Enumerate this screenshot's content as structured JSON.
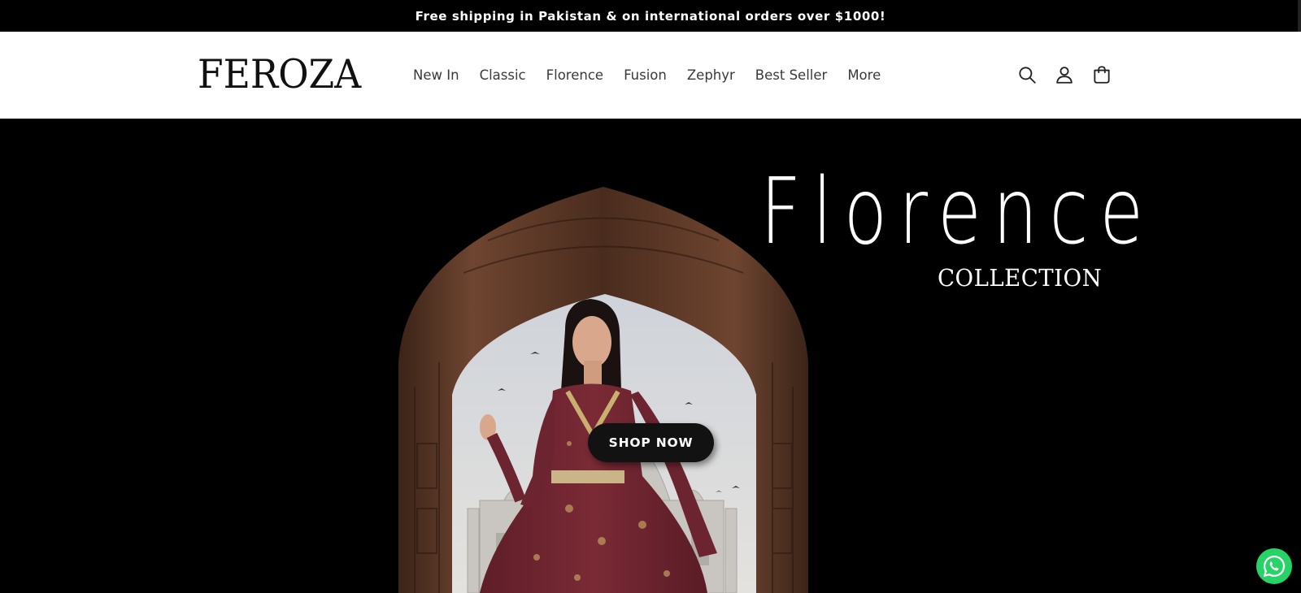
{
  "announcement": {
    "text": "Free shipping in Pakistan & on international orders over $1000!"
  },
  "header": {
    "logo_text": "FEROZA",
    "nav": [
      {
        "label": "New In"
      },
      {
        "label": "Classic"
      },
      {
        "label": "Florence"
      },
      {
        "label": "Fusion"
      },
      {
        "label": "Zephyr"
      },
      {
        "label": "Best Seller"
      },
      {
        "label": "More"
      }
    ],
    "icons": {
      "search": "search-icon",
      "account": "account-icon",
      "cart": "cart-icon"
    }
  },
  "hero": {
    "title": "Florence",
    "subtitle": "COLLECTION",
    "cta_label": "SHOP NOW",
    "image": "woman-in-maroon-dress-taj-mahal-arch"
  },
  "floating": {
    "whatsapp_icon": "whatsapp-icon"
  },
  "colors": {
    "background": "#000000",
    "header": "#ffffff",
    "button": "#121212",
    "whatsapp": "#25D366",
    "dress": "#7a2a35"
  }
}
